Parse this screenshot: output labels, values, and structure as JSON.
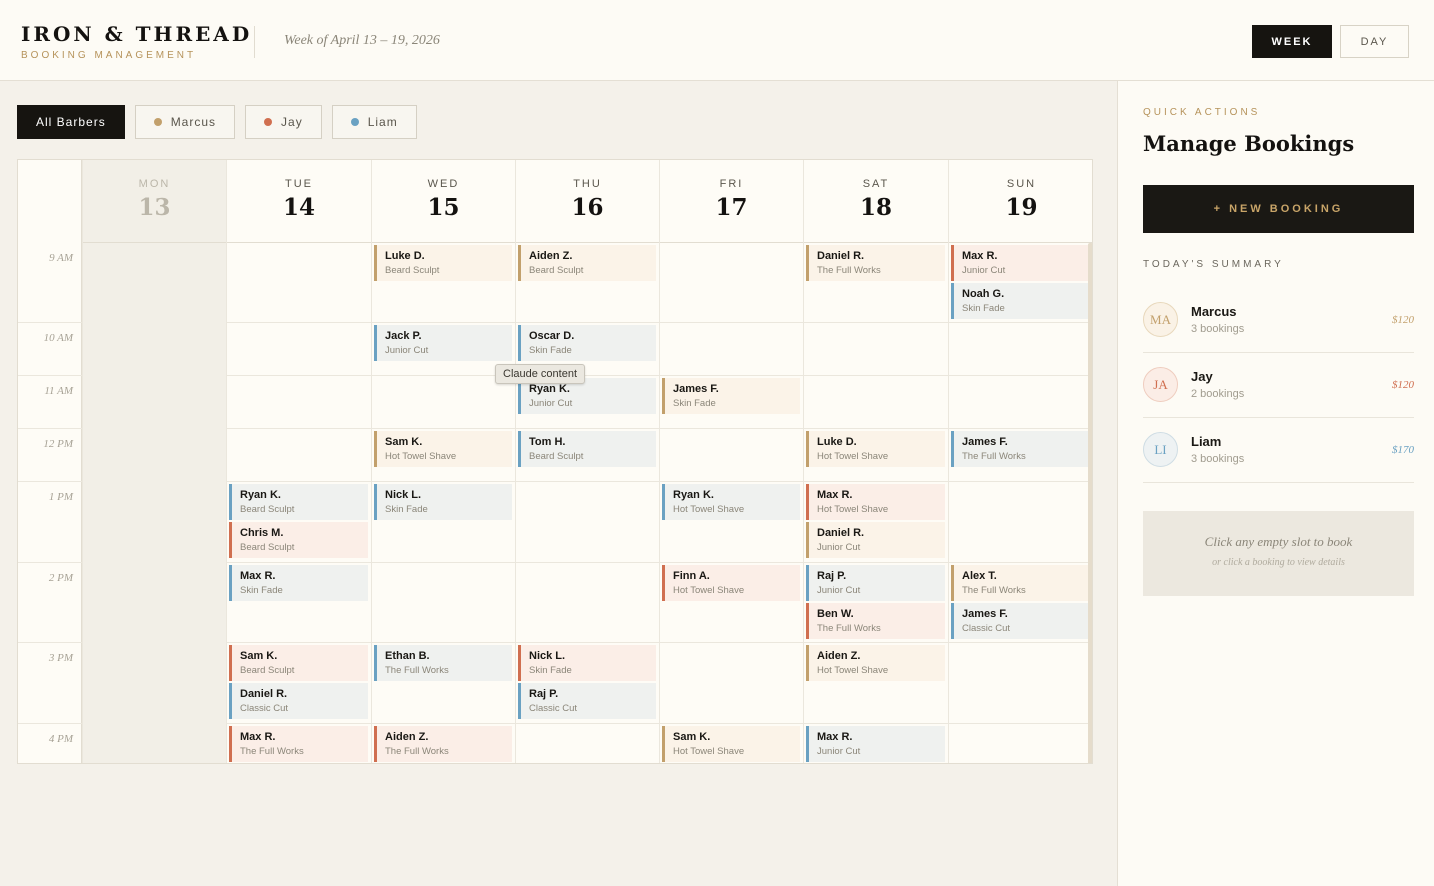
{
  "header": {
    "brand_title": "IRON & THREAD",
    "brand_subtitle": "BOOKING MANAGEMENT",
    "week_label": "Week of April 13 – 19, 2026",
    "view_week": "WEEK",
    "view_day": "DAY"
  },
  "filters": [
    {
      "label": "All Barbers",
      "color": ""
    },
    {
      "label": "Marcus",
      "color": "#c2a06c"
    },
    {
      "label": "Jay",
      "color": "#d06f50"
    },
    {
      "label": "Liam",
      "color": "#6aa1c2"
    }
  ],
  "days": [
    {
      "dow": "MON",
      "num": "13",
      "today": true
    },
    {
      "dow": "TUE",
      "num": "14"
    },
    {
      "dow": "WED",
      "num": "15"
    },
    {
      "dow": "THU",
      "num": "16"
    },
    {
      "dow": "FRI",
      "num": "17"
    },
    {
      "dow": "SAT",
      "num": "18"
    },
    {
      "dow": "SUN",
      "num": "19"
    }
  ],
  "hours": [
    "9 AM",
    "10 AM",
    "11 AM",
    "12 PM",
    "1 PM",
    "2 PM",
    "3 PM",
    "4 PM"
  ],
  "bookings": [
    {
      "day": 2,
      "hour": 0,
      "slot": 0,
      "name": "Luke D.",
      "service": "Beard Sculpt",
      "barber": "marcus"
    },
    {
      "day": 3,
      "hour": 0,
      "slot": 0,
      "name": "Aiden Z.",
      "service": "Beard Sculpt",
      "barber": "marcus"
    },
    {
      "day": 5,
      "hour": 0,
      "slot": 0,
      "name": "Daniel R.",
      "service": "The Full Works",
      "barber": "marcus"
    },
    {
      "day": 6,
      "hour": 0,
      "slot": 0,
      "name": "Max R.",
      "service": "Junior Cut",
      "barber": "jay"
    },
    {
      "day": 6,
      "hour": 0,
      "slot": 1,
      "name": "Noah G.",
      "service": "Skin Fade",
      "barber": "liam"
    },
    {
      "day": 2,
      "hour": 1,
      "slot": 0,
      "name": "Jack P.",
      "service": "Junior Cut",
      "barber": "liam"
    },
    {
      "day": 3,
      "hour": 1,
      "slot": 0,
      "name": "Oscar D.",
      "service": "Skin Fade",
      "barber": "liam"
    },
    {
      "day": 3,
      "hour": 2,
      "slot": 0,
      "name": "Ryan K.",
      "service": "Junior Cut",
      "barber": "liam"
    },
    {
      "day": 4,
      "hour": 2,
      "slot": 0,
      "name": "James F.",
      "service": "Skin Fade",
      "barber": "marcus"
    },
    {
      "day": 2,
      "hour": 3,
      "slot": 0,
      "name": "Sam K.",
      "service": "Hot Towel Shave",
      "barber": "marcus"
    },
    {
      "day": 3,
      "hour": 3,
      "slot": 0,
      "name": "Tom H.",
      "service": "Beard Sculpt",
      "barber": "liam"
    },
    {
      "day": 5,
      "hour": 3,
      "slot": 0,
      "name": "Luke D.",
      "service": "Hot Towel Shave",
      "barber": "marcus"
    },
    {
      "day": 6,
      "hour": 3,
      "slot": 0,
      "name": "James F.",
      "service": "The Full Works",
      "barber": "liam"
    },
    {
      "day": 1,
      "hour": 4,
      "slot": 0,
      "name": "Ryan K.",
      "service": "Beard Sculpt",
      "barber": "liam"
    },
    {
      "day": 1,
      "hour": 4,
      "slot": 1,
      "name": "Chris M.",
      "service": "Beard Sculpt",
      "barber": "jay"
    },
    {
      "day": 2,
      "hour": 4,
      "slot": 0,
      "name": "Nick L.",
      "service": "Skin Fade",
      "barber": "liam"
    },
    {
      "day": 4,
      "hour": 4,
      "slot": 0,
      "name": "Ryan K.",
      "service": "Hot Towel Shave",
      "barber": "liam"
    },
    {
      "day": 5,
      "hour": 4,
      "slot": 0,
      "name": "Max R.",
      "service": "Hot Towel Shave",
      "barber": "jay"
    },
    {
      "day": 5,
      "hour": 4,
      "slot": 1,
      "name": "Daniel R.",
      "service": "Junior Cut",
      "barber": "marcus"
    },
    {
      "day": 1,
      "hour": 5,
      "slot": 0,
      "name": "Max R.",
      "service": "Skin Fade",
      "barber": "liam"
    },
    {
      "day": 4,
      "hour": 5,
      "slot": 0,
      "name": "Finn A.",
      "service": "Hot Towel Shave",
      "barber": "jay"
    },
    {
      "day": 5,
      "hour": 5,
      "slot": 0,
      "name": "Raj P.",
      "service": "Junior Cut",
      "barber": "liam"
    },
    {
      "day": 5,
      "hour": 5,
      "slot": 1,
      "name": "Ben W.",
      "service": "The Full Works",
      "barber": "jay"
    },
    {
      "day": 6,
      "hour": 5,
      "slot": 0,
      "name": "Alex T.",
      "service": "The Full Works",
      "barber": "marcus"
    },
    {
      "day": 6,
      "hour": 5,
      "slot": 1,
      "name": "James F.",
      "service": "Classic Cut",
      "barber": "liam"
    },
    {
      "day": 1,
      "hour": 6,
      "slot": 0,
      "name": "Sam K.",
      "service": "Beard Sculpt",
      "barber": "jay"
    },
    {
      "day": 1,
      "hour": 6,
      "slot": 1,
      "name": "Daniel R.",
      "service": "Classic Cut",
      "barber": "liam"
    },
    {
      "day": 2,
      "hour": 6,
      "slot": 0,
      "name": "Ethan B.",
      "service": "The Full Works",
      "barber": "liam"
    },
    {
      "day": 3,
      "hour": 6,
      "slot": 0,
      "name": "Nick L.",
      "service": "Skin Fade",
      "barber": "jay"
    },
    {
      "day": 3,
      "hour": 6,
      "slot": 1,
      "name": "Raj P.",
      "service": "Classic Cut",
      "barber": "liam"
    },
    {
      "day": 5,
      "hour": 6,
      "slot": 0,
      "name": "Aiden Z.",
      "service": "Hot Towel Shave",
      "barber": "marcus"
    },
    {
      "day": 1,
      "hour": 7,
      "slot": 0,
      "name": "Max R.",
      "service": "The Full Works",
      "barber": "jay"
    },
    {
      "day": 2,
      "hour": 7,
      "slot": 0,
      "name": "Aiden Z.",
      "service": "The Full Works",
      "barber": "jay"
    },
    {
      "day": 4,
      "hour": 7,
      "slot": 0,
      "name": "Sam K.",
      "service": "Hot Towel Shave",
      "barber": "marcus"
    },
    {
      "day": 5,
      "hour": 7,
      "slot": 0,
      "name": "Max R.",
      "service": "Junior Cut",
      "barber": "liam"
    }
  ],
  "tooltip": "Claude content",
  "sidebar": {
    "quick_actions": "QUICK ACTIONS",
    "title": "Manage Bookings",
    "new_booking": "+ NEW BOOKING",
    "summary_label": "TODAY'S SUMMARY",
    "summary": [
      {
        "initials": "MA",
        "name": "Marcus",
        "count": "3 bookings",
        "amount": "$120",
        "color": "#c2a06c",
        "key": "marcus"
      },
      {
        "initials": "JA",
        "name": "Jay",
        "count": "2 bookings",
        "amount": "$120",
        "color": "#d06f50",
        "key": "jay"
      },
      {
        "initials": "LI",
        "name": "Liam",
        "count": "3 bookings",
        "amount": "$170",
        "color": "#6aa1c2",
        "key": "liam"
      }
    ],
    "hint_primary": "Click any empty slot to book",
    "hint_secondary": "or click a booking to view details"
  }
}
